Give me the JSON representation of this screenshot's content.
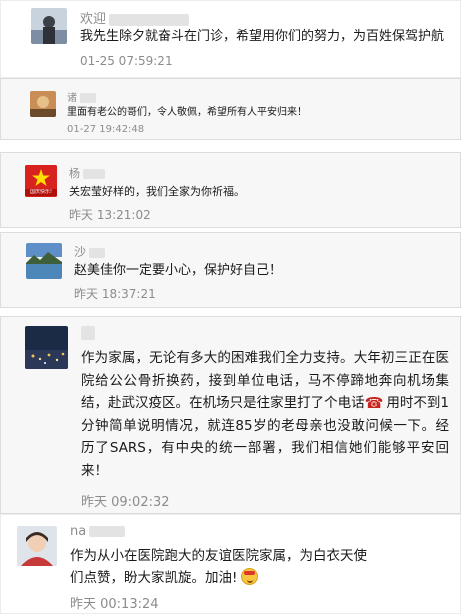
{
  "comments": [
    {
      "name": "欢迎",
      "text": "我先生除夕就奋斗在门诊，希望用你们的努力，为百姓保驾护航",
      "time": "01-25 07:59:21"
    },
    {
      "name": "诸",
      "text": "里面有老公的哥们，令人敬佩，希望所有人平安归来！",
      "time": "01-27 19:42:48"
    },
    {
      "name": "杨",
      "avatar_badge": "国庆快乐!",
      "text": "关宏莹好样的，我们全家为你祈福。",
      "time": "昨天 13:21:02"
    },
    {
      "name": "沙",
      "text": "赵美佳你一定要小心，保护好自己！",
      "time": "昨天 18:37:21"
    },
    {
      "name": "",
      "text_parts": [
        "作为家属，无论有多大的困难我们全力支持。大年初三正在医院给公公骨折换药，接到单位电话，马不停蹄地奔向机场集结，赴武汉疫区。在机场只是往家里打了个电话",
        "用时不到1分钟简单说明情况，就连85岁的老母亲也没敢问候一下。经历了SARS，有中央的统一部署，我们相信她们能够平安回来！"
      ],
      "phone_icon": "☎",
      "time": "昨天 09:02:32"
    },
    {
      "name": "na",
      "text": "作为从小在医院跑大的友谊医院家属，为白衣天使们点赞，盼大家凯旋。加油!",
      "emoji_icon": "cheering-face-emoji",
      "time": "昨天 00:13:24"
    }
  ]
}
